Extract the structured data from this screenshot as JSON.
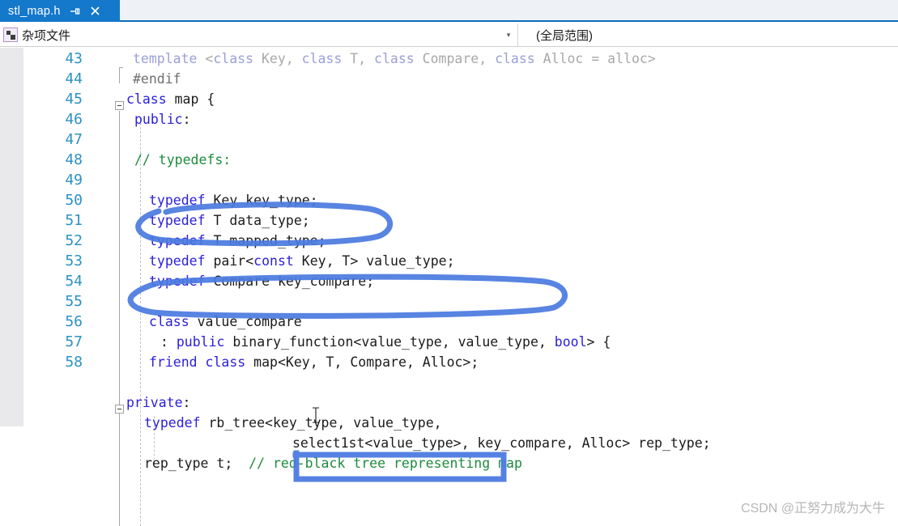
{
  "window": {
    "tab": {
      "title": "stl_map.h",
      "pin_icon": "pin-icon",
      "close_icon": "close-icon"
    }
  },
  "navbar": {
    "project_icon": "miscellaneous-file-icon",
    "scope": "杂项文件",
    "scope_arrow": "▾",
    "member": "(全局范围)"
  },
  "editor": {
    "first_line_number": 43,
    "line_numbers": [
      "43",
      "44",
      "45",
      "46",
      "47",
      "48",
      "49",
      "50",
      "51",
      "52",
      "53",
      "54",
      "55",
      "56",
      "57",
      "58"
    ],
    "lines": [
      {
        "n": "43",
        "segments": [
          {
            "t": "template ",
            "c": "dim"
          },
          {
            "t": "<",
            "c": "dimtxt"
          },
          {
            "t": "class",
            "c": "dim"
          },
          {
            "t": " Key, ",
            "c": "dimtxt"
          },
          {
            "t": "class",
            "c": "dim"
          },
          {
            "t": " T, ",
            "c": "dimtxt"
          },
          {
            "t": "class",
            "c": "dim"
          },
          {
            "t": " Compare, ",
            "c": "dimtxt"
          },
          {
            "t": "class",
            "c": "dim"
          },
          {
            "t": " Alloc = alloc>",
            "c": "dimtxt"
          }
        ]
      },
      {
        "n": "44",
        "segments": [
          {
            "t": "#endif",
            "c": "pp"
          }
        ]
      },
      {
        "n": "45",
        "segments": [
          {
            "t": "class",
            "c": "kw"
          },
          {
            "t": " map {",
            "c": "plain"
          }
        ]
      },
      {
        "n": "46",
        "segments": [
          {
            "t": "public",
            "c": "kw"
          },
          {
            "t": ":",
            "c": "plain"
          }
        ]
      },
      {
        "n": "47",
        "segments": []
      },
      {
        "n": "48",
        "segments": [
          {
            "t": "// typedefs:",
            "c": "cmt"
          }
        ]
      },
      {
        "n": "49",
        "segments": []
      },
      {
        "n": "50",
        "segments": [
          {
            "t": "typedef",
            "c": "kw"
          },
          {
            "t": " Key key_type;",
            "c": "plain"
          }
        ]
      },
      {
        "n": "51",
        "segments": [
          {
            "t": "typedef",
            "c": "kw"
          },
          {
            "t": " T data_type;",
            "c": "plain"
          }
        ]
      },
      {
        "n": "52",
        "segments": [
          {
            "t": "typedef",
            "c": "kw"
          },
          {
            "t": " T mapped_type;",
            "c": "plain"
          }
        ]
      },
      {
        "n": "53",
        "segments": [
          {
            "t": "typedef",
            "c": "kw"
          },
          {
            "t": " pair<",
            "c": "plain"
          },
          {
            "t": "const",
            "c": "kw"
          },
          {
            "t": " Key, T> value_type;",
            "c": "plain"
          }
        ]
      },
      {
        "n": "54",
        "segments": [
          {
            "t": "typedef",
            "c": "kw"
          },
          {
            "t": " Compare key_compare;",
            "c": "plain"
          }
        ]
      },
      {
        "n": "55",
        "segments": []
      },
      {
        "n": "56",
        "segments": [
          {
            "t": "class",
            "c": "kw"
          },
          {
            "t": " value_compare",
            "c": "plain"
          }
        ]
      },
      {
        "n": "57",
        "segments": [
          {
            "t": ": ",
            "c": "plain"
          },
          {
            "t": "public",
            "c": "kw"
          },
          {
            "t": " binary_function<value_type, value_type, ",
            "c": "plain"
          },
          {
            "t": "bool",
            "c": "kw"
          },
          {
            "t": "> {",
            "c": "plain"
          }
        ]
      },
      {
        "n": "58",
        "segments": [
          {
            "t": "friend",
            "c": "kw"
          },
          {
            "t": " ",
            "c": "plain"
          },
          {
            "t": "class",
            "c": "kw"
          },
          {
            "t": " map<Key, T, Compare, Alloc>;",
            "c": "plain"
          }
        ]
      },
      {
        "n": "",
        "segments": []
      },
      {
        "n": "",
        "segments": [
          {
            "t": "private",
            "c": "kw"
          },
          {
            "t": ":",
            "c": "plain"
          }
        ]
      },
      {
        "n": "",
        "segments": [
          {
            "t": "typedef",
            "c": "kw"
          },
          {
            "t": " rb_tree<key_type, value_type,",
            "c": "plain"
          }
        ]
      },
      {
        "n": "",
        "segments": [
          {
            "t": "select1st<value_type>, key_compare, Alloc> rep_type;",
            "c": "plain"
          }
        ]
      },
      {
        "n": "",
        "segments": [
          {
            "t": "rep_type t;  ",
            "c": "plain"
          },
          {
            "t": "// red-black tree representing map",
            "c": "cmt"
          }
        ]
      }
    ]
  },
  "annotations": {
    "color": "#4a7ae0",
    "shapes": [
      {
        "name": "ellipse-typedef-key-type",
        "kind": "ellipse"
      },
      {
        "name": "ellipse-typedef-value-type",
        "kind": "ellipse"
      },
      {
        "name": "rect-rb-tree-params",
        "kind": "rectangle"
      }
    ]
  },
  "watermark": {
    "text": "CSDN @正努力成为大牛"
  },
  "colors": {
    "tab_active_bg": "#1478cb",
    "tab_underline": "#0d6cb8",
    "tabstrip_bg": "#eef1f6",
    "linenumber": "#2b91c4",
    "keyword": "#2b20d8",
    "comment": "#1c8b3c",
    "inactive_code": "#a8a8a8",
    "annotation_blue": "#4a7ae0",
    "selection_margin": "#e9e9ec"
  }
}
